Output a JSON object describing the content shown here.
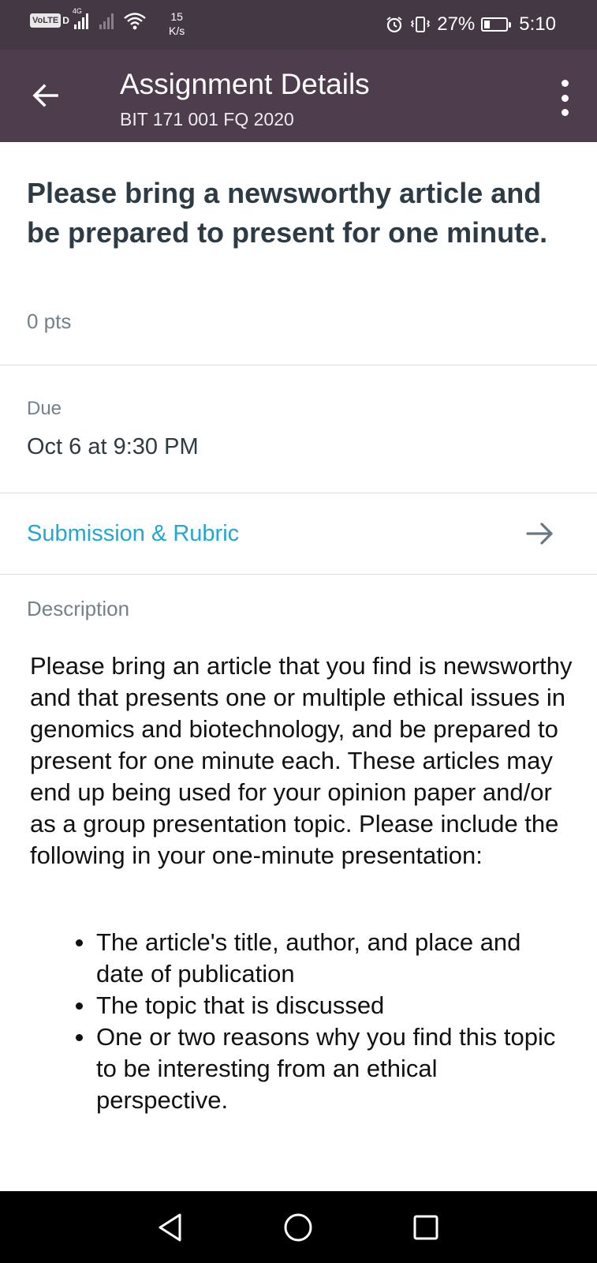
{
  "status_bar": {
    "volte": "VoLTE",
    "network_type": "4G",
    "net_speed_value": "15",
    "net_speed_unit": "K/s",
    "battery_percent": "27%",
    "battery_level": 0.27,
    "time": "5:10",
    "icons": [
      "alarm-icon",
      "vibrate-icon",
      "wifi-icon",
      "signal-icon"
    ]
  },
  "app_bar": {
    "title": "Assignment Details",
    "subtitle": "BIT 171 001 FQ 2020",
    "back_icon": "arrow-back-icon",
    "menu_icon": "more-vert-icon"
  },
  "assignment": {
    "title": "Please bring a newsworthy article and be prepared to present for one minute.",
    "points": "0 pts"
  },
  "due": {
    "label": "Due",
    "value": "Oct 6 at 9:30 PM"
  },
  "submission": {
    "label": "Submission & Rubric",
    "icon": "arrow-forward-icon"
  },
  "description": {
    "label": "Description",
    "body": "Please bring an article that you find is newsworthy and that presents one or multiple ethical issues in genomics and biotechnology, and be prepared to present for one minute each. These articles may end up being used for your opinion paper and/or as a group presentation topic. Please include the following in your one-minute presentation:",
    "items": [
      "The article's title, author, and place and date of publication",
      "The topic that is discussed",
      "One or two reasons why you find this topic to be interesting from an ethical perspective."
    ]
  },
  "colors": {
    "status_bar_bg": "#433843",
    "app_bar_bg": "#4d3d4d",
    "link": "#22a7cf",
    "heading": "#2d3b45",
    "muted": "#73818c"
  }
}
